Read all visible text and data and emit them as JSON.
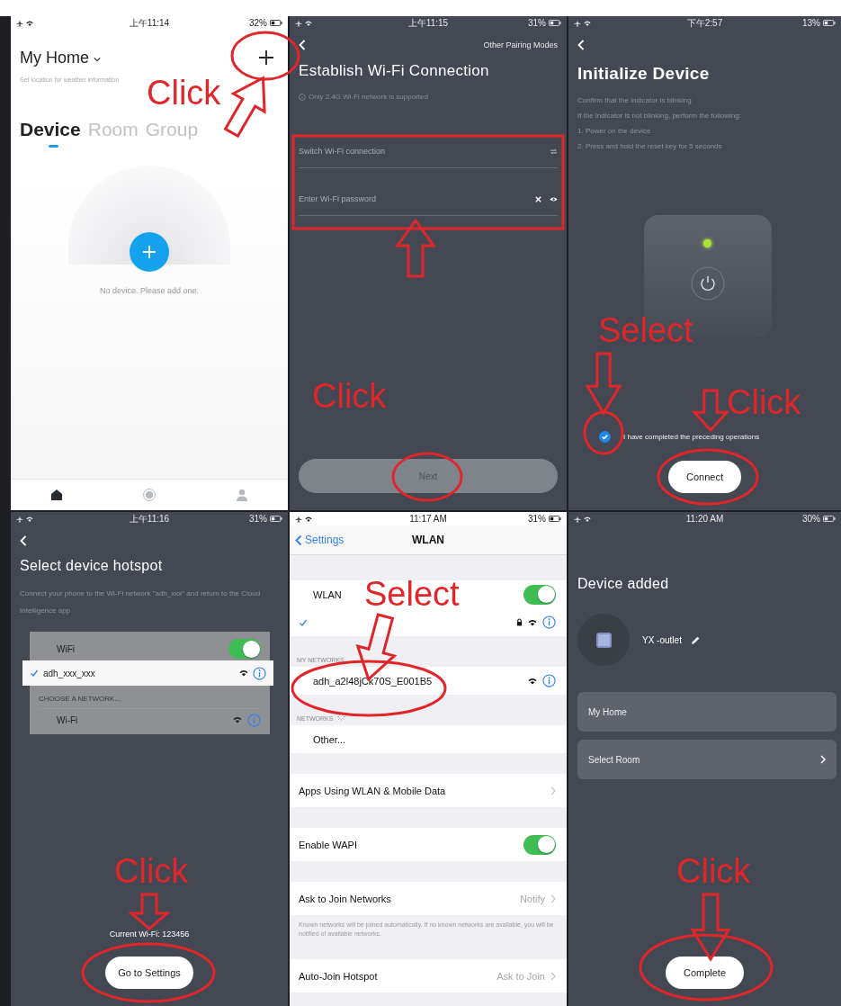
{
  "home": {
    "time": "上午11:14",
    "battery": "32%",
    "title": "My Home",
    "subtitle": "Set location for weather information",
    "tabs": [
      {
        "label": "Device",
        "selected": true
      },
      {
        "label": "Room",
        "selected": false
      },
      {
        "label": "Group",
        "selected": false
      }
    ],
    "empty_text": "No device. Please add one.",
    "nav": [
      {
        "selected": true
      },
      {
        "selected": false
      },
      {
        "selected": false
      }
    ]
  },
  "wifi": {
    "time": "上午11:15",
    "battery": "31%",
    "link": "Other Pairing Modes",
    "title": "Establish Wi-Fi Connection",
    "note": "Only 2.4G Wi-Fi network is supported",
    "ssid_placeholder": "Switch Wi-Fi connection",
    "password_placeholder": "Enter Wi-Fi password",
    "button": {
      "label": "Next",
      "disabled": true
    }
  },
  "init": {
    "time": "下午2:57",
    "battery": "13%",
    "title": "Initialize Device",
    "lines": [
      "Confirm that the indicator is blinking",
      "If the indicator is not blinking, perform the following:",
      "1. Power on the device",
      "2. Press and hold the reset key for 5 seconds"
    ],
    "checkbox": {
      "label": "I have completed the preceding operations",
      "checked": true
    },
    "button": "Connect"
  },
  "hotspot": {
    "time": "上午11:16",
    "battery": "31%",
    "title": "Select device hotspot",
    "description": "Connect your phone to the Wi-Fi network \"adh_xxx\" and return to the Cloud Intelligence app",
    "wifi_toggle": {
      "label": "WiFi",
      "on": true
    },
    "connected": {
      "name": "adh_xxx_xxx",
      "selected": true
    },
    "section": "CHOOSE A NETWORK...",
    "network": "Wi-Fi",
    "current_wifi": "Current Wi-Fi: 123456",
    "button": "Go to Settings"
  },
  "wlan": {
    "time": "11:17 AM",
    "battery": "31%",
    "back": "Settings",
    "title": "WLAN",
    "wlan_toggle": {
      "label": "WLAN",
      "on": true
    },
    "my_networks_header": "MY NETWORKS",
    "my_networks": [
      "adh_a2l48jCk70S_E001B5"
    ],
    "networks_header": "NETWORKS",
    "other": "Other...",
    "settings": [
      {
        "kind": "link",
        "label": "Apps Using WLAN & Mobile Data"
      },
      {
        "kind": "toggle",
        "label": "Enable WAPI",
        "on": true
      },
      {
        "kind": "link",
        "label": "Ask to Join Networks",
        "value": "Notify",
        "footnote": "Known networks will be joined automatically. If no known networks are available, you will be notified of available networks."
      },
      {
        "kind": "link",
        "label": "Auto-Join Hotspot",
        "value": "Ask to Join"
      }
    ]
  },
  "added": {
    "time": "11:20 AM",
    "battery": "30%",
    "title": "Device added",
    "device_name": "YX -outlet",
    "rows": [
      {
        "label": "My Home",
        "chevron": false
      },
      {
        "label": "Select Room",
        "chevron": true
      }
    ],
    "button": "Complete"
  },
  "annotations": [
    {
      "text": "Click"
    },
    {
      "text": "Click"
    },
    {
      "text": "Select"
    },
    {
      "text": "Click"
    },
    {
      "text": "Click"
    },
    {
      "text": "Select"
    },
    {
      "text": "Click"
    }
  ]
}
